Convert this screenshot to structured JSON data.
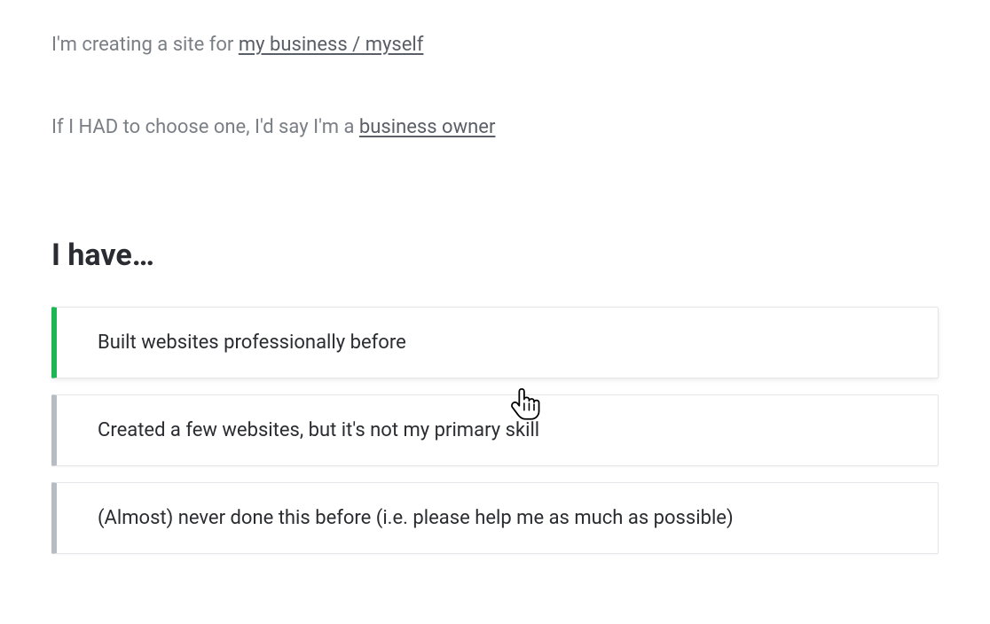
{
  "previous": [
    {
      "prefix": "I'm creating a site for ",
      "link": "my business / myself"
    },
    {
      "prefix": "If I HAD to choose one, I'd say I'm a ",
      "link": "business owner"
    }
  ],
  "question": "I have…",
  "options": [
    {
      "label": "Built websites professionally before",
      "hovered": true
    },
    {
      "label": "Created a few websites, but it's not my primary skill",
      "hovered": false
    },
    {
      "label": "(Almost) never done this before (i.e. please help me as much as possible)",
      "hovered": false
    }
  ]
}
